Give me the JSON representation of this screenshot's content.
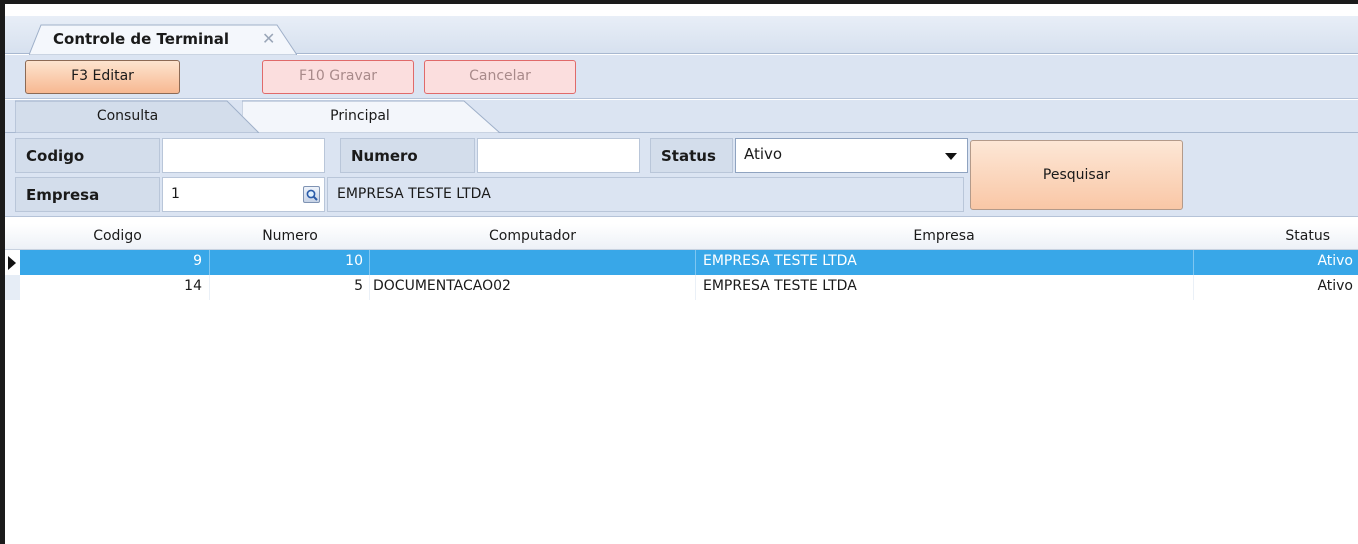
{
  "document_tab": {
    "title": "Controle de Terminal",
    "close_glyph": "✕"
  },
  "toolbar": {
    "edit_label": "F3 Editar",
    "save_label": "F10 Gravar",
    "cancel_label": "Cancelar"
  },
  "page_tabs": [
    {
      "label": "Consulta"
    },
    {
      "label": "Principal"
    }
  ],
  "filters": {
    "codigo_label": "Codigo",
    "codigo_value": "",
    "numero_label": "Numero",
    "numero_value": "",
    "status_label": "Status",
    "status_selected": "Ativo",
    "empresa_label": "Empresa",
    "empresa_value": "1",
    "empresa_name": "EMPRESA TESTE LTDA",
    "search_label": "Pesquisar",
    "lookup_icon": "magnifier-icon"
  },
  "grid": {
    "columns": [
      "Codigo",
      "Numero",
      "Computador",
      "Empresa",
      "Status"
    ],
    "rows": [
      {
        "codigo": "9",
        "numero": "10",
        "computador": "",
        "empresa": "EMPRESA TESTE LTDA",
        "status": "Ativo",
        "selected": true
      },
      {
        "codigo": "14",
        "numero": "5",
        "computador": "DOCUMENTACAO02",
        "empresa": "EMPRESA TESTE LTDA",
        "status": "Ativo",
        "selected": false
      }
    ]
  },
  "colors": {
    "selection": "#38a7e8",
    "panel": "#dbe4f2",
    "button_active": "#f7b891",
    "button_disabled_border": "#e06a6a"
  }
}
